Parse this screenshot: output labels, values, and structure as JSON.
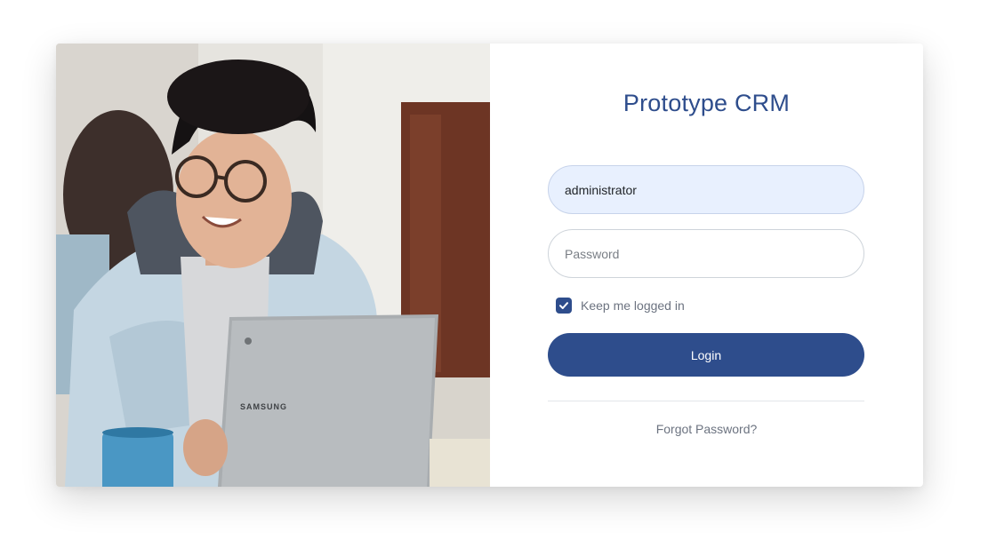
{
  "app": {
    "title": "Prototype CRM"
  },
  "hero_image": {
    "icon": "person-with-laptop-photo",
    "laptop_brand": "SAMSUNG"
  },
  "login_form": {
    "username_value": "administrator",
    "password_placeholder": "Password",
    "remember_label": "Keep me logged in",
    "remember_checked": true,
    "login_label": "Login",
    "forgot_label": "Forgot Password?"
  },
  "colors": {
    "brand": "#2e4d8c",
    "autofill_bg": "#e8f0fe",
    "muted_text": "#6c7380"
  }
}
